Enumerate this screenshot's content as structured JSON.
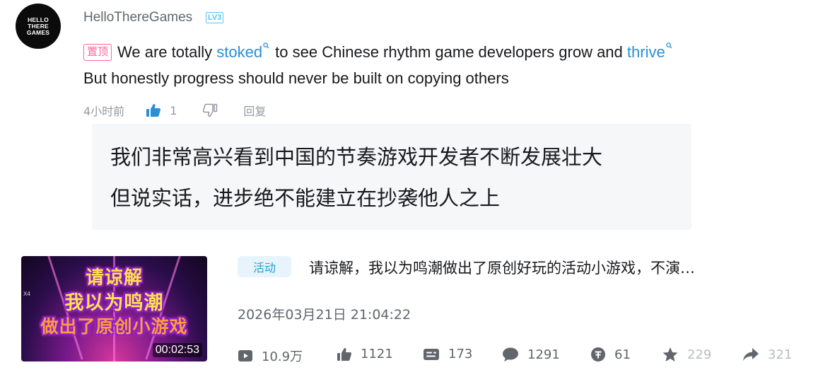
{
  "comment": {
    "avatar_text": [
      "HELLO",
      "THERE",
      "GAMES"
    ],
    "username": "HelloThereGames",
    "level_badge": "LV3",
    "pin_label": "置顶",
    "line1_parts": [
      "We are totally ",
      "stoked",
      " to see Chinese rhythm game developers grow and ",
      "thrive"
    ],
    "line2": "But honestly progress should never be built on copying others",
    "time": "4小时前",
    "like_count": "1",
    "reply_label": "回复"
  },
  "translation": {
    "line1": "我们非常高兴看到中国的节奏游戏开发者不断发展壮大",
    "line2": "但说实话，进步绝不能建立在抄袭他人之上"
  },
  "video": {
    "thumbnail_lines": [
      "请谅解",
      "我以为鸣潮",
      "做出了原创小游戏"
    ],
    "thumbnail_badge": "X4",
    "duration": "00:02:53",
    "tag": "活动",
    "title": "请谅解，我以为鸣潮做出了原创好玩的活动小游戏，不演…",
    "date": "2026年03月21日 21:04:22",
    "stats": {
      "views": "10.9万",
      "likes": "1121",
      "danmaku": "173",
      "comments": "1291",
      "coins": "61",
      "favorites": "229",
      "shares": "321"
    }
  },
  "colors": {
    "keyword_blue": "#2a8fd6",
    "pin_pink": "#ff6699",
    "like_blue": "#2a8fd6",
    "tag_bg": "#e8f4fb"
  },
  "icons": {
    "like": "thumbs-up-icon",
    "dislike": "thumbs-down-icon",
    "views": "play-icon",
    "danmaku": "danmaku-icon",
    "comments": "comment-icon",
    "coins": "coin-icon",
    "favorites": "star-icon",
    "shares": "share-icon"
  }
}
